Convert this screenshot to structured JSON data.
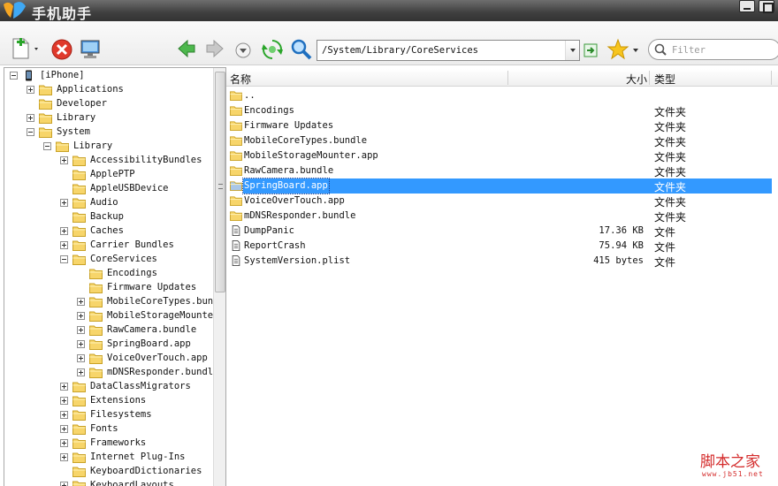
{
  "window": {
    "title": "手机助手"
  },
  "toolbar": {
    "path": "/System/Library/CoreServices",
    "filter_placeholder": "Filter"
  },
  "tree": {
    "items": [
      {
        "label": "[iPhone]",
        "depth": 0,
        "expander": "minus",
        "icon": "iphone-icon"
      },
      {
        "label": "Applications",
        "depth": 1,
        "expander": "plus",
        "icon": "folder-icon"
      },
      {
        "label": "Developer",
        "depth": 1,
        "expander": "none",
        "icon": "folder-icon"
      },
      {
        "label": "Library",
        "depth": 1,
        "expander": "plus",
        "icon": "folder-icon"
      },
      {
        "label": "System",
        "depth": 1,
        "expander": "minus",
        "icon": "folder-icon"
      },
      {
        "label": "Library",
        "depth": 2,
        "expander": "minus",
        "icon": "folder-icon"
      },
      {
        "label": "AccessibilityBundles",
        "depth": 3,
        "expander": "plus",
        "icon": "folder-icon"
      },
      {
        "label": "ApplePTP",
        "depth": 3,
        "expander": "none",
        "icon": "folder-icon"
      },
      {
        "label": "AppleUSBDevice",
        "depth": 3,
        "expander": "none",
        "icon": "folder-icon"
      },
      {
        "label": "Audio",
        "depth": 3,
        "expander": "plus",
        "icon": "folder-icon"
      },
      {
        "label": "Backup",
        "depth": 3,
        "expander": "none",
        "icon": "folder-icon"
      },
      {
        "label": "Caches",
        "depth": 3,
        "expander": "plus",
        "icon": "folder-icon"
      },
      {
        "label": "Carrier Bundles",
        "depth": 3,
        "expander": "plus",
        "icon": "folder-icon"
      },
      {
        "label": "CoreServices",
        "depth": 3,
        "expander": "minus",
        "icon": "folder-icon"
      },
      {
        "label": "Encodings",
        "depth": 4,
        "expander": "none",
        "icon": "folder-icon"
      },
      {
        "label": "Firmware Updates",
        "depth": 4,
        "expander": "none",
        "icon": "folder-icon"
      },
      {
        "label": "MobileCoreTypes.bun",
        "depth": 4,
        "expander": "plus",
        "icon": "folder-icon"
      },
      {
        "label": "MobileStorageMounte",
        "depth": 4,
        "expander": "plus",
        "icon": "folder-icon"
      },
      {
        "label": "RawCamera.bundle",
        "depth": 4,
        "expander": "plus",
        "icon": "folder-icon"
      },
      {
        "label": "SpringBoard.app",
        "depth": 4,
        "expander": "plus",
        "icon": "folder-icon"
      },
      {
        "label": "VoiceOverTouch.app",
        "depth": 4,
        "expander": "plus",
        "icon": "folder-icon"
      },
      {
        "label": "mDNSResponder.bundl",
        "depth": 4,
        "expander": "plus",
        "icon": "folder-icon"
      },
      {
        "label": "DataClassMigrators",
        "depth": 3,
        "expander": "plus",
        "icon": "folder-icon"
      },
      {
        "label": "Extensions",
        "depth": 3,
        "expander": "plus",
        "icon": "folder-icon"
      },
      {
        "label": "Filesystems",
        "depth": 3,
        "expander": "plus",
        "icon": "folder-icon"
      },
      {
        "label": "Fonts",
        "depth": 3,
        "expander": "plus",
        "icon": "folder-icon"
      },
      {
        "label": "Frameworks",
        "depth": 3,
        "expander": "plus",
        "icon": "folder-icon"
      },
      {
        "label": "Internet Plug-Ins",
        "depth": 3,
        "expander": "plus",
        "icon": "folder-icon"
      },
      {
        "label": "KeyboardDictionaries",
        "depth": 3,
        "expander": "none",
        "icon": "folder-icon"
      },
      {
        "label": "KeyboardLayouts",
        "depth": 3,
        "expander": "plus",
        "icon": "folder-icon"
      }
    ]
  },
  "list": {
    "columns": {
      "name": "名称",
      "size": "大小",
      "type": "类型"
    },
    "rows": [
      {
        "name": "..",
        "size": "",
        "type": "",
        "icon": "folder-icon",
        "selected": false
      },
      {
        "name": "Encodings",
        "size": "",
        "type": "文件夹",
        "icon": "folder-icon",
        "selected": false
      },
      {
        "name": "Firmware Updates",
        "size": "",
        "type": "文件夹",
        "icon": "folder-icon",
        "selected": false
      },
      {
        "name": "MobileCoreTypes.bundle",
        "size": "",
        "type": "文件夹",
        "icon": "folder-icon",
        "selected": false
      },
      {
        "name": "MobileStorageMounter.app",
        "size": "",
        "type": "文件夹",
        "icon": "folder-icon",
        "selected": false
      },
      {
        "name": "RawCamera.bundle",
        "size": "",
        "type": "文件夹",
        "icon": "folder-icon",
        "selected": false
      },
      {
        "name": "SpringBoard.app",
        "size": "",
        "type": "文件夹",
        "icon": "folder-icon",
        "selected": true
      },
      {
        "name": "VoiceOverTouch.app",
        "size": "",
        "type": "文件夹",
        "icon": "folder-icon",
        "selected": false
      },
      {
        "name": "mDNSResponder.bundle",
        "size": "",
        "type": "文件夹",
        "icon": "folder-icon",
        "selected": false
      },
      {
        "name": "DumpPanic",
        "size": "17.36 KB",
        "type": "文件",
        "icon": "file-icon",
        "selected": false
      },
      {
        "name": "ReportCrash",
        "size": "75.94 KB",
        "type": "文件",
        "icon": "file-icon",
        "selected": false
      },
      {
        "name": "SystemVersion.plist",
        "size": "415 bytes",
        "type": "文件",
        "icon": "file-icon",
        "selected": false
      }
    ]
  },
  "watermark": {
    "text": "脚本之家",
    "url": "www.jb51.net"
  },
  "colors": {
    "selection": "#3399ff",
    "folder": "#f7d56a",
    "titlebar": "#444444"
  }
}
